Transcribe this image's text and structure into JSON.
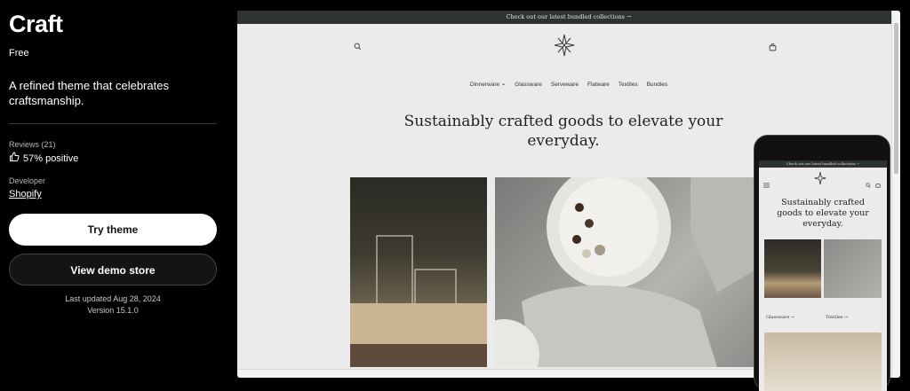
{
  "theme": {
    "title": "Craft",
    "price": "Free",
    "tagline": "A refined theme that celebrates craftsmanship.",
    "reviews_label": "Reviews (21)",
    "reviews_positive": "57% positive",
    "developer_label": "Developer",
    "developer_name": "Shopify",
    "try_button": "Try theme",
    "demo_button": "View demo store",
    "last_updated": "Last updated Aug 28, 2024",
    "version": "Version 15.1.0"
  },
  "preview": {
    "announcement": "Check out our latest bundled collections →",
    "nav": [
      "Dinnerware",
      "Glassware",
      "Serveware",
      "Flatware",
      "Textiles",
      "Bundles"
    ],
    "hero_title": "Sustainably crafted goods to elevate your everyday.",
    "mobile_announcement": "Check out our latest bundled collections →",
    "mobile_hero_title": "Sustainably crafted goods to elevate your everyday.",
    "mobile_card1_label": "Glassware →",
    "mobile_card2_label": "Textiles →"
  },
  "colors": {
    "background": "#000000",
    "preview_bg": "#ecebeb",
    "announcement_bg": "#2e332f"
  },
  "icons": [
    "thumbs-up-icon",
    "search-icon",
    "logo-star-icon",
    "cart-icon",
    "chevron-down-icon",
    "menu-icon"
  ]
}
